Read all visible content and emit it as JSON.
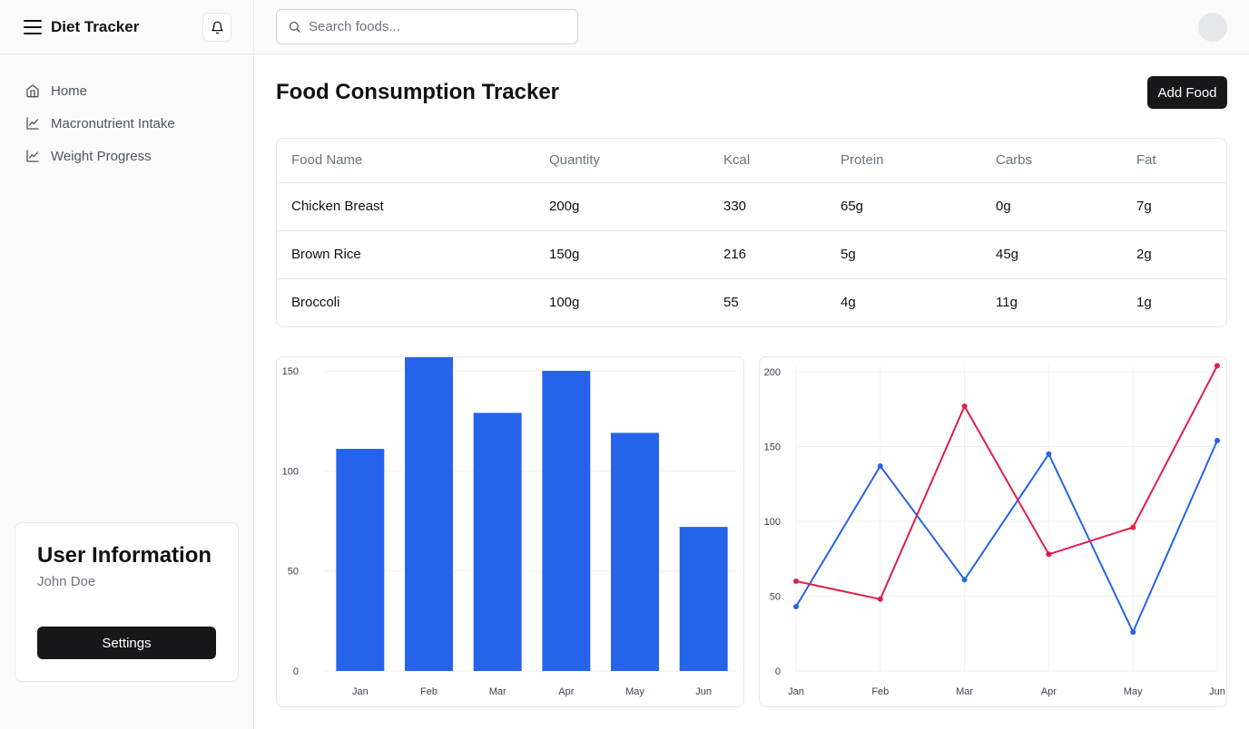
{
  "app": {
    "title": "Diet Tracker"
  },
  "icons": {
    "menu": "menu-icon",
    "bell": "bell-icon",
    "home": "home-icon",
    "chart": "line-chart-icon",
    "search": "search-icon"
  },
  "sidebar": {
    "items": [
      {
        "label": "Home",
        "icon": "home-icon"
      },
      {
        "label": "Macronutrient Intake",
        "icon": "line-chart-icon"
      },
      {
        "label": "Weight Progress",
        "icon": "line-chart-icon"
      }
    ]
  },
  "user_card": {
    "title": "User Information",
    "name": "John Doe",
    "settings_label": "Settings"
  },
  "search": {
    "placeholder": "Search foods..."
  },
  "main": {
    "title": "Food Consumption Tracker",
    "add_label": "Add Food"
  },
  "table": {
    "headers": [
      "Food Name",
      "Quantity",
      "Kcal",
      "Protein",
      "Carbs",
      "Fat"
    ],
    "rows": [
      [
        "Chicken Breast",
        "200g",
        "330",
        "65g",
        "0g",
        "7g"
      ],
      [
        "Brown Rice",
        "150g",
        "216",
        "5g",
        "45g",
        "2g"
      ],
      [
        "Broccoli",
        "100g",
        "55",
        "4g",
        "11g",
        "1g"
      ]
    ]
  },
  "colors": {
    "bar": "#2563eb",
    "line_blue": "#2563eb",
    "line_red": "#e11d48",
    "button_dark": "#18181b"
  },
  "chart_data": [
    {
      "type": "bar",
      "categories": [
        "Jan",
        "Feb",
        "Mar",
        "Apr",
        "May",
        "Jun"
      ],
      "values": [
        111,
        157,
        129,
        150,
        119,
        72
      ],
      "ylim": [
        0,
        150
      ],
      "yticks": [
        0,
        50,
        100,
        150
      ],
      "grid": true,
      "title": "",
      "xlabel": "",
      "ylabel": ""
    },
    {
      "type": "line",
      "categories": [
        "Jan",
        "Feb",
        "Mar",
        "Apr",
        "May",
        "Jun"
      ],
      "series": [
        {
          "values": [
            43,
            137,
            61,
            145,
            26,
            154
          ],
          "color": "#2563eb"
        },
        {
          "values": [
            60,
            48,
            177,
            78,
            96,
            204
          ],
          "color": "#e11d48"
        }
      ],
      "ylim": [
        0,
        200
      ],
      "yticks": [
        0,
        50,
        100,
        150,
        200
      ],
      "grid": true,
      "title": "",
      "xlabel": "",
      "ylabel": ""
    }
  ]
}
